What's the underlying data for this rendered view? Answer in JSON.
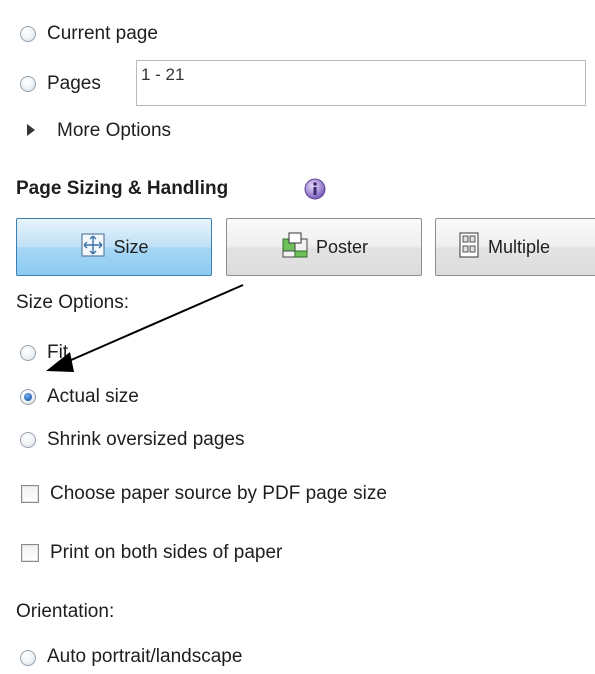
{
  "page_range": {
    "current_page_label": "Current page",
    "pages_label": "Pages",
    "pages_value": "1 - 21",
    "more_options_label": "More Options"
  },
  "page_sizing": {
    "heading": "Page Sizing & Handling",
    "buttons": {
      "size": "Size",
      "poster": "Poster",
      "multiple": "Multiple"
    },
    "size_options_label": "Size Options:",
    "fit_label": "Fit",
    "actual_size_label": "Actual size",
    "shrink_label": "Shrink oversized pages",
    "selected_option": "Actual size",
    "choose_paper_label": "Choose paper source by PDF page size",
    "both_sides_label": "Print on both sides of paper"
  },
  "orientation": {
    "label": "Orientation:",
    "auto_label": "Auto portrait/landscape"
  },
  "colors": {
    "active_button": "#8ccbf1",
    "info_icon": "#8a6fc4",
    "arrow": "#000000"
  }
}
